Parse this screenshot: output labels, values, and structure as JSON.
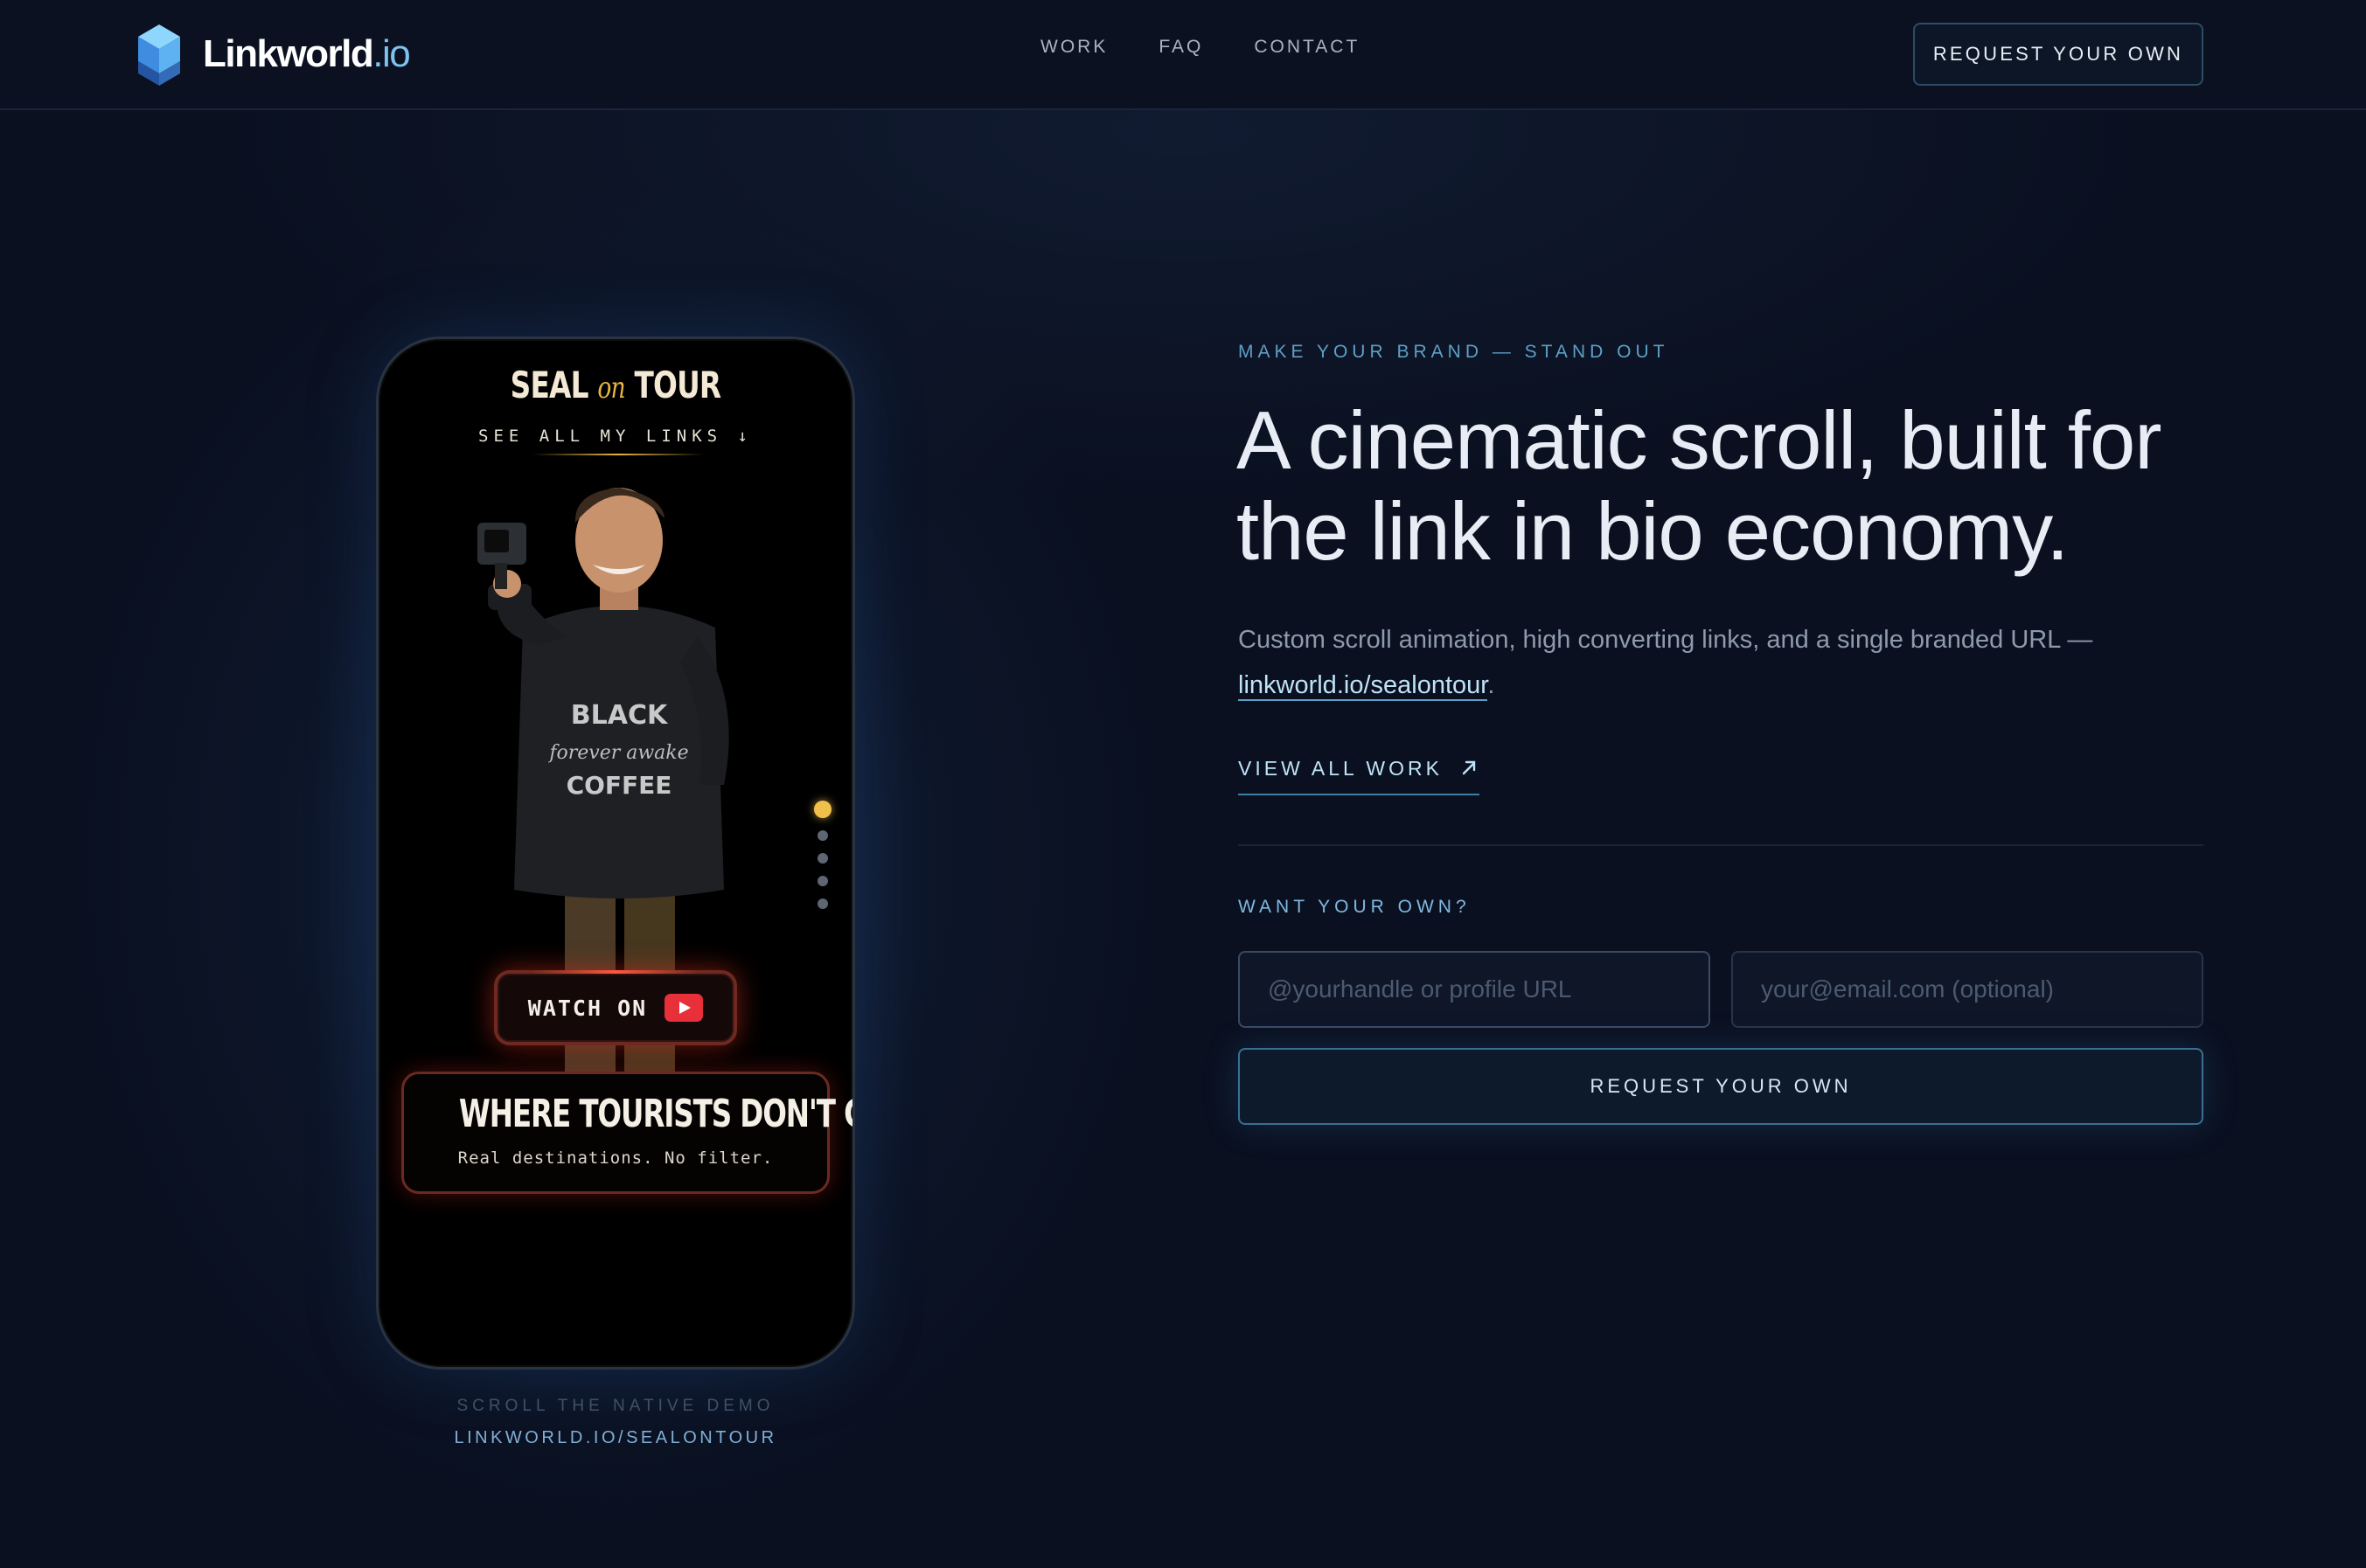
{
  "brand": {
    "name": "Linkworld",
    "tld": ".io",
    "logo_icon": "cube-logo-icon",
    "accent_color": "#7dc3f0"
  },
  "nav": {
    "links": [
      "WORK",
      "FAQ",
      "CONTACT"
    ],
    "cta_label": "REQUEST YOUR OWN"
  },
  "phone": {
    "title_left": "SEAL",
    "title_mid": "on",
    "title_right": "TOUR",
    "see_all": "SEE ALL MY LINKS ↓",
    "watch_label": "WATCH ON",
    "watch_icon": "youtube-icon",
    "card_title": "WHERE TOURISTS DON'T GO",
    "card_subtitle": "Real destinations. No filter.",
    "pagination": {
      "total": 5,
      "active": 1
    },
    "active_dot_color": "#f1c04b"
  },
  "demo_caption": {
    "line1": "SCROLL THE NATIVE DEMO",
    "line2": "LINKWORLD.IO/SEALONTOUR"
  },
  "hero": {
    "eyebrow": "MAKE YOUR BRAND — STAND OUT",
    "headline": "A cinematic scroll, built for the link in bio economy.",
    "lead_text": "Custom scroll animation, high converting links, and a single branded URL —",
    "lead_link": "linkworld.io/sealontour",
    "lead_end": ".",
    "view_all": "VIEW ALL WORK",
    "view_all_icon": "arrow-up-right-icon"
  },
  "form": {
    "title": "WANT YOUR OWN?",
    "handle_placeholder": "@yourhandle or profile URL",
    "email_placeholder": "your@email.com (optional)",
    "submit_label": "REQUEST YOUR OWN"
  }
}
